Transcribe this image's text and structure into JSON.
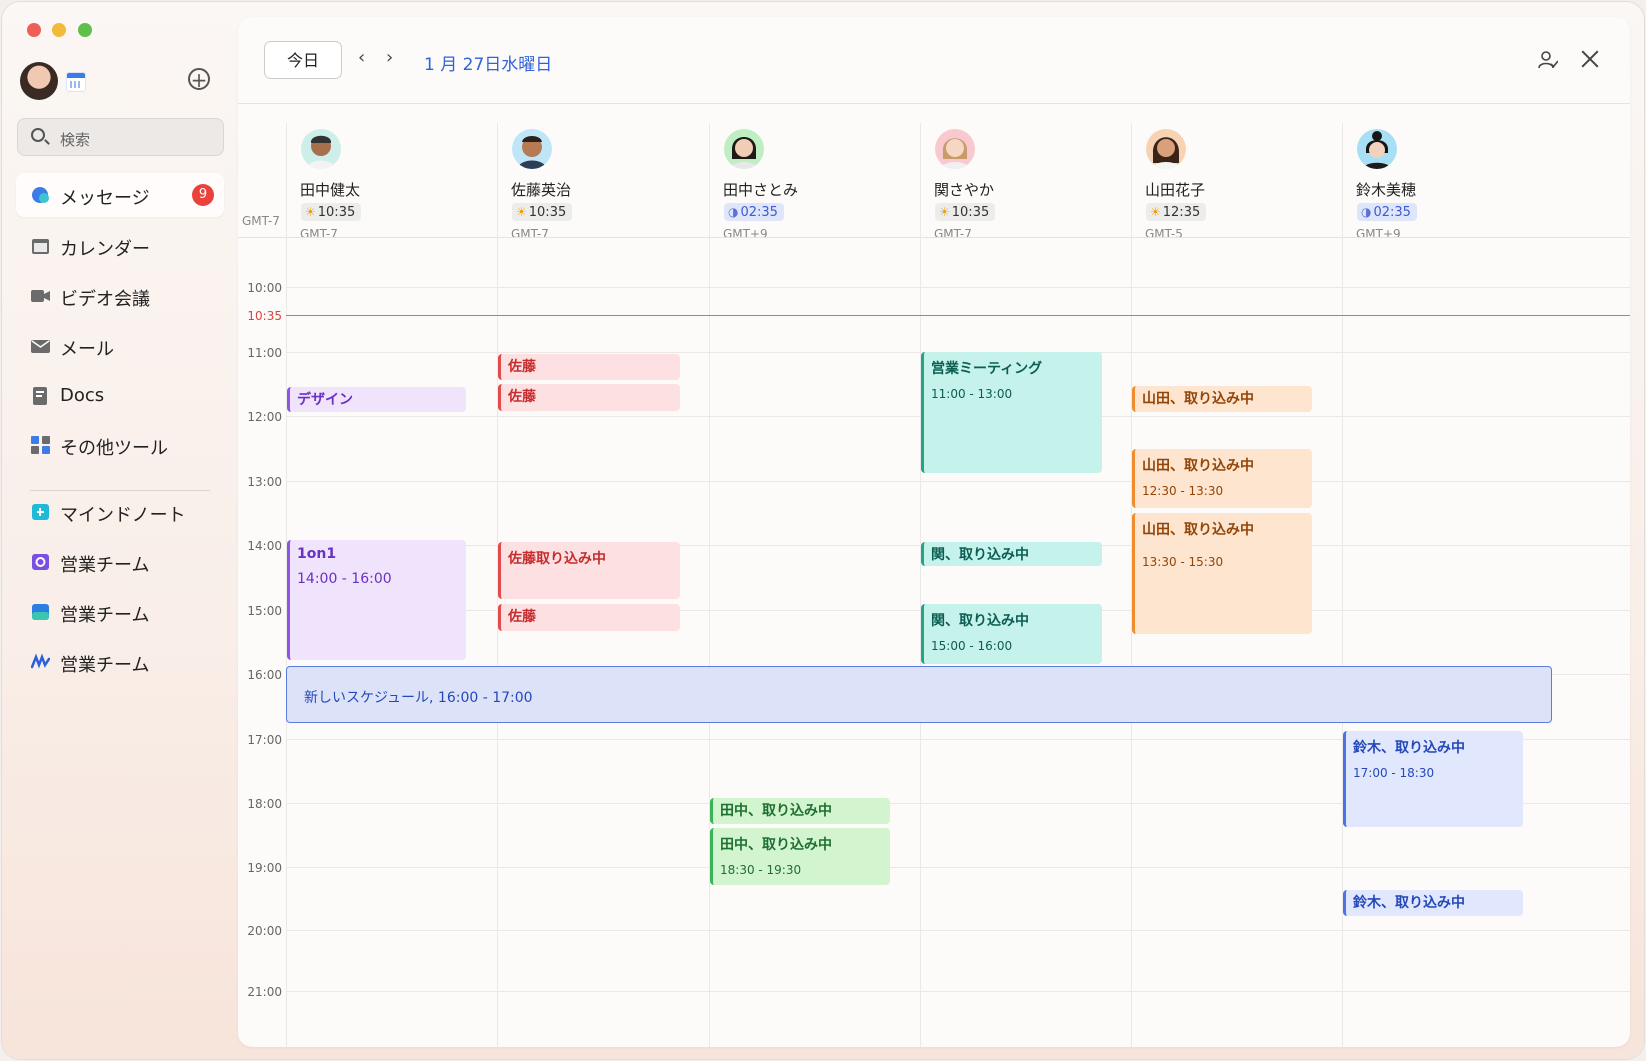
{
  "sidebar": {
    "search_placeholder": "検索",
    "nav": [
      {
        "label": "メッセージ",
        "badge": "9",
        "icon": "message-icon"
      },
      {
        "label": "カレンダー",
        "icon": "calendar-icon"
      },
      {
        "label": "ビデオ会議",
        "icon": "video-icon"
      },
      {
        "label": "メール",
        "icon": "mail-icon"
      },
      {
        "label": "Docs",
        "icon": "docs-icon"
      },
      {
        "label": "その他ツール",
        "icon": "apps-icon"
      }
    ],
    "groups": [
      {
        "label": "マインドノート",
        "icon": "mindnote-icon"
      },
      {
        "label": "営業チーム",
        "icon": "team-icon"
      },
      {
        "label": "営業チーム",
        "icon": "team-icon"
      },
      {
        "label": "営業チーム",
        "icon": "team-icon"
      }
    ]
  },
  "toolbar": {
    "today_label": "今日",
    "prev": "‹",
    "next": "›",
    "date": "1 月 27日水曜日"
  },
  "timezone_label": "GMT-7",
  "people": [
    {
      "name": "田中健太",
      "time": "10:35",
      "period": "day",
      "gmt": "GMT-7"
    },
    {
      "name": "佐藤英治",
      "time": "10:35",
      "period": "day",
      "gmt": "GMT-7"
    },
    {
      "name": "田中さとみ",
      "time": "02:35",
      "period": "night",
      "gmt": "GMT+9"
    },
    {
      "name": "関さやか",
      "time": "10:35",
      "period": "day",
      "gmt": "GMT-7"
    },
    {
      "name": "山田花子",
      "time": "12:35",
      "period": "day",
      "gmt": "GMT-5"
    },
    {
      "name": "鈴木美穂",
      "time": "02:35",
      "period": "night",
      "gmt": "GMT+9"
    }
  ],
  "hours": [
    "10:00",
    "11:00",
    "12:00",
    "13:00",
    "14:00",
    "15:00",
    "16:00",
    "17:00",
    "18:00",
    "19:00",
    "20:00",
    "21:00"
  ],
  "now_label": "10:35",
  "events": [
    {
      "title": "デザイン",
      "color": "purple"
    },
    {
      "title": "1on1",
      "time": "14:00 - 16:00",
      "color": "purple"
    },
    {
      "title": "佐藤",
      "color": "red"
    },
    {
      "title": "佐藤",
      "color": "red"
    },
    {
      "title": "佐藤取り込み中",
      "color": "red"
    },
    {
      "title": "佐藤",
      "color": "red"
    },
    {
      "title": "田中、取り込み中",
      "color": "green"
    },
    {
      "title": "田中、取り込み中",
      "time": "18:30 - 19:30",
      "color": "green"
    },
    {
      "title": "営業ミーティング",
      "time": "11:00 - 13:00",
      "color": "teal"
    },
    {
      "title": "関、取り込み中",
      "color": "teal"
    },
    {
      "title": "関、取り込み中",
      "time": "15:00 - 16:00",
      "color": "teal"
    },
    {
      "title": "山田、取り込み中",
      "color": "orange"
    },
    {
      "title": "山田、取り込み中",
      "time": "12:30 - 13:30",
      "color": "orange"
    },
    {
      "title": "山田、取り込み中",
      "time": "13:30 - 15:30",
      "color": "orange"
    },
    {
      "title": "鈴木、取り込み中",
      "time": "17:00 - 18:30",
      "color": "blue"
    },
    {
      "title": "鈴木、取り込み中",
      "color": "blue"
    },
    {
      "title": "新しいスケジュール, 16:00 - 17:00",
      "color": "new"
    }
  ]
}
